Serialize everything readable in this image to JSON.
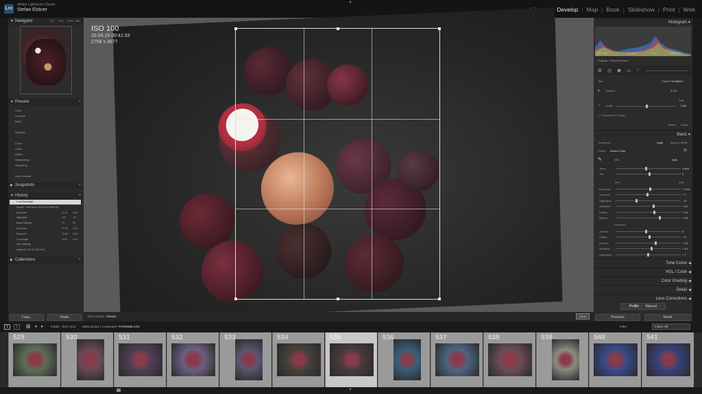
{
  "app": {
    "product": "Adobe Lightroom Classic",
    "owner": "Stefan Elstner",
    "logo": "Lrc"
  },
  "modules": [
    "Library",
    "Develop",
    "Map",
    "Book",
    "Slideshow",
    "Print",
    "Web"
  ],
  "active_module": "Develop",
  "left": {
    "navigator": {
      "title": "Navigator",
      "zoom": [
        "FIT",
        "FILL",
        "100%",
        "33%"
      ]
    },
    "presets": {
      "title": "Presets",
      "groups": [
        "Color",
        "Creative",
        "B&W",
        "Defaults",
        "Curve",
        "Grain",
        "Optics",
        "Sharpening",
        "Vignetting",
        "User Presets"
      ]
    },
    "snapshots": {
      "title": "Snapshots"
    },
    "history": {
      "title": "History",
      "items": [
        {
          "label": "Crop Rectangle",
          "a": "",
          "b": "",
          "selected": true
        },
        {
          "label": "Export - Hard Drive (16.03.21 09:46:18)",
          "a": "",
          "b": ""
        },
        {
          "label": "Exposure",
          "a": "-0.14",
          "b": "0.04"
        },
        {
          "label": "Highlights",
          "a": "-14",
          "b": "-37"
        },
        {
          "label": "Black Clipping",
          "a": "+4",
          "b": "33"
        },
        {
          "label": "Exposure",
          "a": "+0.10",
          "b": "0.04"
        },
        {
          "label": "Exposure",
          "a": "+0.56",
          "b": "0.04"
        },
        {
          "label": "Crop Angle",
          "a": "-3.62",
          "b": "3.62"
        },
        {
          "label": "Auto Settings",
          "a": "",
          "b": ""
        },
        {
          "label": "Import (27.02.21 18:13:54)",
          "a": "",
          "b": ""
        }
      ]
    },
    "collections": {
      "title": "Collections"
    },
    "copy": "Copy...",
    "paste": "Paste"
  },
  "photo_meta": {
    "iso": "ISO 100",
    "date": "26.04.16 00:41:33",
    "dims": "2758 x 3677"
  },
  "toolbar": {
    "label": "Tool Overlay :",
    "value": "Always",
    "done": "Done"
  },
  "right": {
    "histogram": {
      "title": "Histogram",
      "iso": "ISO 100",
      "focal": "35 mm",
      "aperture": "f / 1,8",
      "shutter": "1/800 sec",
      "preview": "Original + Smart Preview"
    },
    "crop": {
      "tool": "Tool",
      "tool_name": "Crop & Straighten",
      "aspect": "Aspect :",
      "aspect_val": "4 x 5",
      "auto": "Auto",
      "angle": "Angle",
      "angle_val": "-3.62",
      "constrain": "Constrain to Image",
      "reset": "Reset",
      "close": "Close"
    },
    "basic": {
      "title": "Basic",
      "treatment": "Treatment :",
      "color": "Color",
      "bw": "Black & White",
      "profile": "Profile :",
      "profile_val": "Adobe Color",
      "wb": "WB :",
      "wb_val": "Auto",
      "rows": [
        {
          "label": "Temp",
          "value": "4 900",
          "pos": 0.45
        },
        {
          "label": "Tint",
          "value": "0",
          "pos": 0.5
        }
      ],
      "tone": "Tone",
      "tone_auto": "Auto",
      "tone_rows": [
        {
          "label": "Exposure",
          "value": "+ 0,04",
          "pos": 0.52
        },
        {
          "label": "Contrast",
          "value": "+ 7",
          "pos": 0.47
        },
        {
          "label": "Highlights",
          "value": "- 37",
          "pos": 0.3
        },
        {
          "label": "Shadows",
          "value": "+ 14",
          "pos": 0.57
        },
        {
          "label": "Whites",
          "value": "+ 16",
          "pos": 0.58
        },
        {
          "label": "Blacks",
          "value": "+ 33",
          "pos": 0.66
        }
      ],
      "presence": "Presence",
      "presence_rows": [
        {
          "label": "Texture",
          "value": "0",
          "pos": 0.45
        },
        {
          "label": "Clarity",
          "value": "+ 8",
          "pos": 0.5
        },
        {
          "label": "Dehaze",
          "value": "+ 29",
          "pos": 0.6
        },
        {
          "label": "Vibrance",
          "value": "+ 14",
          "pos": 0.54
        },
        {
          "label": "Saturation",
          "value": "+ 7",
          "pos": 0.48
        }
      ]
    },
    "sections": [
      "Tone Curve",
      "HSL / Color",
      "Color Grading",
      "Detail",
      "Lens Corrections"
    ],
    "profile_btn": "Profile",
    "manual_btn": "Manual",
    "previous": "Previous",
    "reset": "Reset"
  },
  "filmbar": {
    "source": "Folder : Sort Food",
    "status": "5895 photos / 1 selected /",
    "file": "P3780486.CR2",
    "filter": "Filter :",
    "filter_val": "Filters Off"
  },
  "filmstrip": [
    {
      "num": "529",
      "color": "#5e6d55",
      "selected": false
    },
    {
      "num": "530",
      "color": "#6a4a56",
      "selected": false
    },
    {
      "num": "531",
      "color": "#4d3f55",
      "selected": false
    },
    {
      "num": "532",
      "color": "#6a5f80",
      "selected": false
    },
    {
      "num": "533",
      "color": "#5a5670",
      "selected": false
    },
    {
      "num": "534",
      "color": "#45403a",
      "selected": false
    },
    {
      "num": "535",
      "color": "#4a3a3a",
      "selected": true
    },
    {
      "num": "536",
      "color": "#3a5f7a",
      "selected": false
    },
    {
      "num": "537",
      "color": "#4d6580",
      "selected": false
    },
    {
      "num": "538",
      "color": "#6a4c55",
      "selected": false
    },
    {
      "num": "539",
      "color": "#8c8c80",
      "selected": false
    },
    {
      "num": "540",
      "color": "#394a8a",
      "selected": false
    },
    {
      "num": "541",
      "color": "#35427a",
      "selected": false
    }
  ]
}
